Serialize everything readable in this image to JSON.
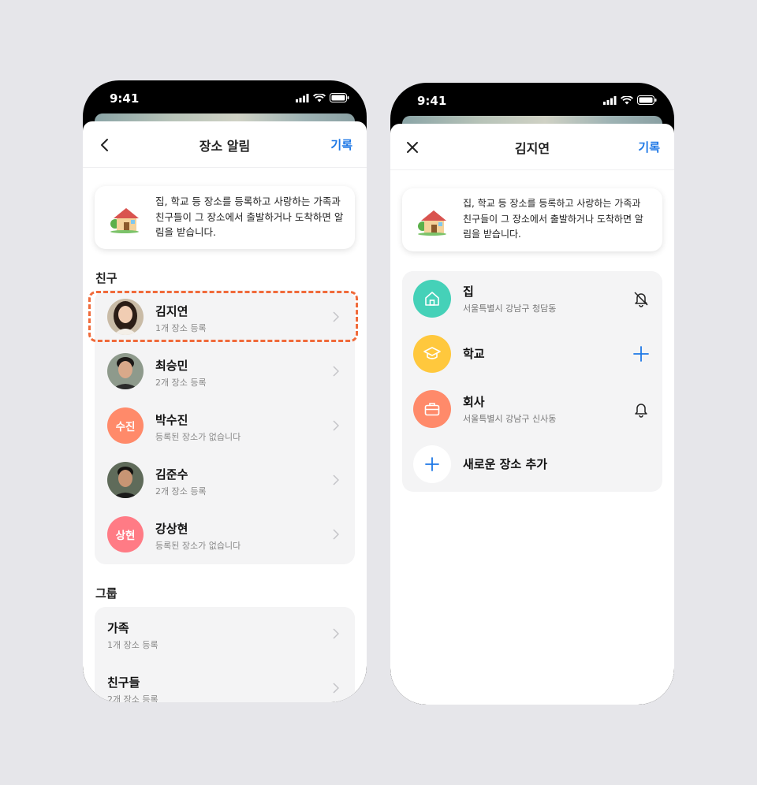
{
  "left_phone": {
    "status": {
      "time": "9:41"
    },
    "nav": {
      "title": "장소 알림",
      "right_label": "기록"
    },
    "info": {
      "text": "집, 학교 등 장소를 등록하고 사랑하는 가족과 친구들이 그 장소에서 출발하거나 도착하면 알림을 받습니다."
    },
    "friends_label": "친구",
    "friends": [
      {
        "name": "김지연",
        "sub": "1개 장소 등록",
        "avatar": "photo"
      },
      {
        "name": "최승민",
        "sub": "2개 장소 등록",
        "avatar": "photo"
      },
      {
        "name": "박수진",
        "sub": "등록된 장소가 없습니다",
        "avatar_text": "수진",
        "avatar_color": "#ff8a6a"
      },
      {
        "name": "김준수",
        "sub": "2개 장소 등록",
        "avatar": "photo"
      },
      {
        "name": "강상현",
        "sub": "등록된 장소가 없습니다",
        "avatar_text": "상현",
        "avatar_color": "#ff7b85"
      }
    ],
    "groups_label": "그룹",
    "groups": [
      {
        "name": "가족",
        "sub": "1개 장소 등록"
      },
      {
        "name": "친구들",
        "sub": "2개 장소 등록"
      }
    ]
  },
  "right_phone": {
    "status": {
      "time": "9:41"
    },
    "nav": {
      "title": "김지연",
      "right_label": "기록"
    },
    "info": {
      "text": "집, 학교 등 장소를 등록하고 사랑하는 가족과 친구들이 그 장소에서 출발하거나 도착하면 알림을 받습니다."
    },
    "places": [
      {
        "name": "집",
        "address": "서울특별시 강남구 청담동",
        "icon": "home-icon",
        "color": "#45d1b8",
        "action": "bell-off-icon"
      },
      {
        "name": "학교",
        "address": "",
        "icon": "graduation-cap-icon",
        "color": "#ffc83d",
        "action": "plus-icon"
      },
      {
        "name": "회사",
        "address": "서울특별시 강남구 신사동",
        "icon": "briefcase-icon",
        "color": "#ff8a6a",
        "action": "bell-icon"
      },
      {
        "name": "새로운 장소 추가",
        "address": "",
        "icon": "plus-icon",
        "color": "#ffffff",
        "action": ""
      }
    ]
  },
  "colors": {
    "accent": "#1e78e6",
    "highlight": "#f06a3a",
    "background": "#e6e6ea"
  }
}
